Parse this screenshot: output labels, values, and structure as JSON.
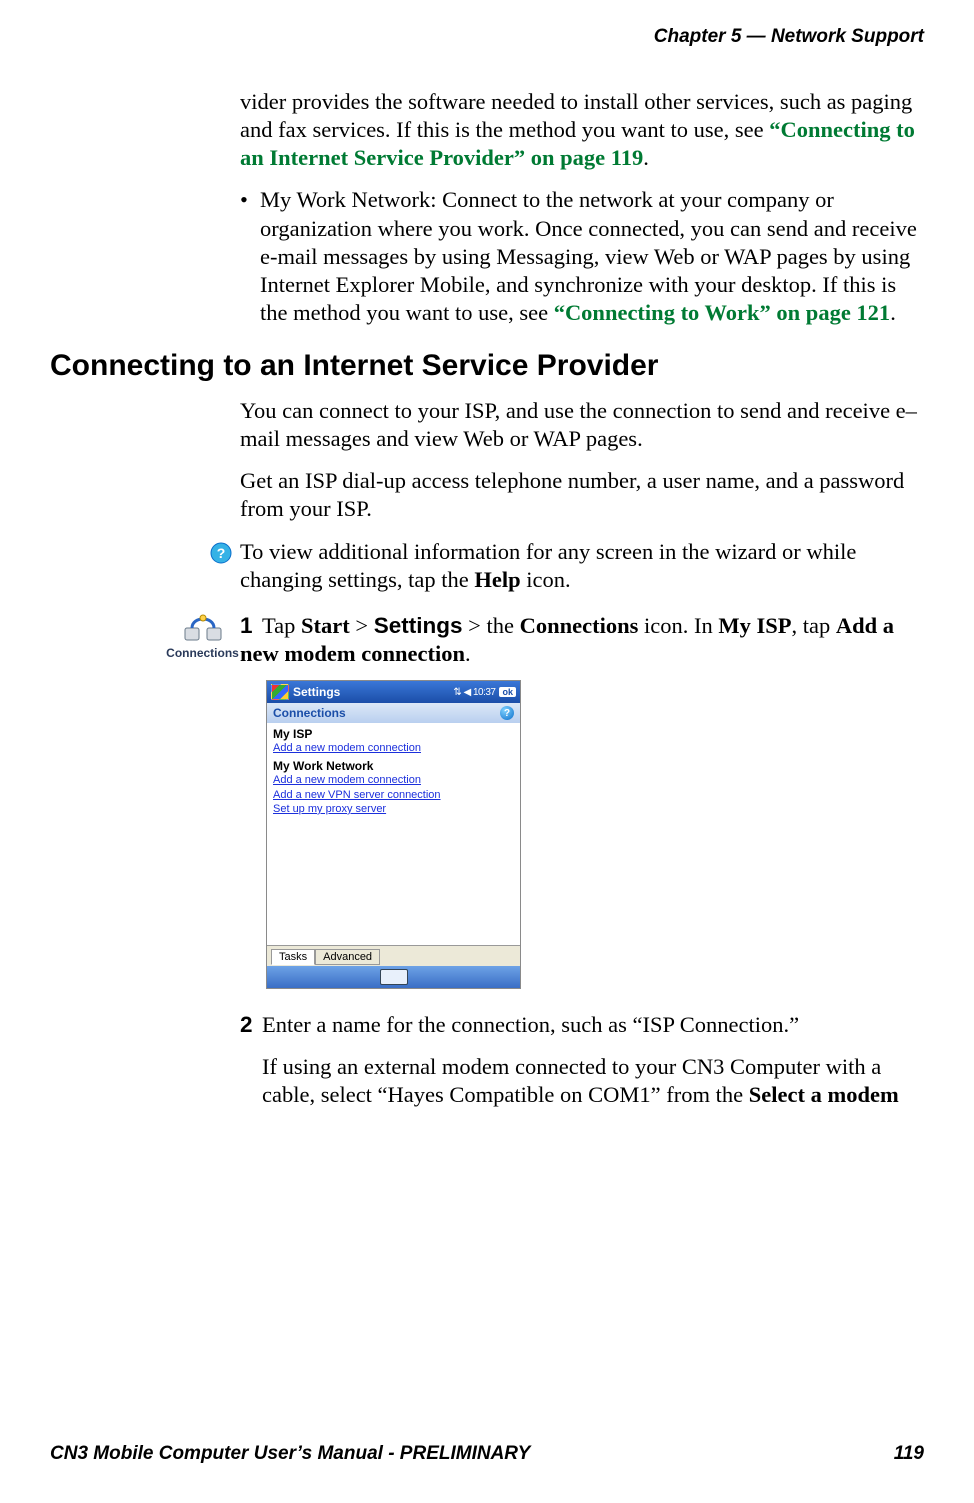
{
  "running_head": "Chapter 5 —  Network Support",
  "intro_para_pre": "vider provides the software needed to install other services, such as paging and fax services. If this is the method you want to use, see ",
  "intro_link": "“Connecting to an Internet Service Provider” on page 119",
  "intro_para_post": ".",
  "bullet1_pre": "My Work Network: Connect to the network at your company or organization where you work. Once connected, you can send and receive e-mail messages by using Messaging, view Web or WAP pages by using Internet Explorer Mobile, and synchronize with your desktop. If this is the method you want to use, see ",
  "bullet1_link": "“Connecting to Work” on page 121",
  "bullet1_post": ".",
  "section_heading": "Connecting to an Internet Service Provider",
  "para1": "You can connect to your ISP, and use the connection to send and receive e–mail messages and view Web or WAP pages.",
  "para2": "Get an ISP dial-up access telephone number, a user name, and a password from your ISP.",
  "tip_pre": "To view additional information for any screen in the wizard or while changing settings, tap the ",
  "tip_bold": "Help",
  "tip_post": " icon.",
  "step1": {
    "num": "1",
    "t1": "Tap ",
    "b1": "Start",
    "t2": " > ",
    "b2_sans": "Settings",
    "t3": " > the ",
    "b3": "Connections",
    "t4": " icon. In ",
    "b4": "My ISP",
    "t5": ", tap ",
    "b5": "Add a new modem connection",
    "t6": "."
  },
  "icon_caption": "Connections",
  "wm": {
    "title": "Settings",
    "status": "⇅ ◀ 10:37",
    "ok": "ok",
    "sub": "Connections",
    "help": "?",
    "grp1": "My ISP",
    "grp1_l1": "Add a new modem connection",
    "grp2": "My Work Network",
    "grp2_l1": "Add a new modem connection",
    "grp2_l2": "Add a new VPN server connection",
    "grp2_l3": "Set up my proxy server",
    "tab1": "Tasks",
    "tab2": "Advanced"
  },
  "step2": {
    "num": "2",
    "text": "Enter a name for the connection, such as “ISP Connection.”"
  },
  "para3_pre": "If using an external modem connected to your CN3 Computer with a cable, select “Hayes Compatible on COM1” from the ",
  "para3_bold": "Select a modem",
  "footer_left": "CN3 Mobile Computer User’s Manual - PRELIMINARY",
  "footer_right": "119"
}
